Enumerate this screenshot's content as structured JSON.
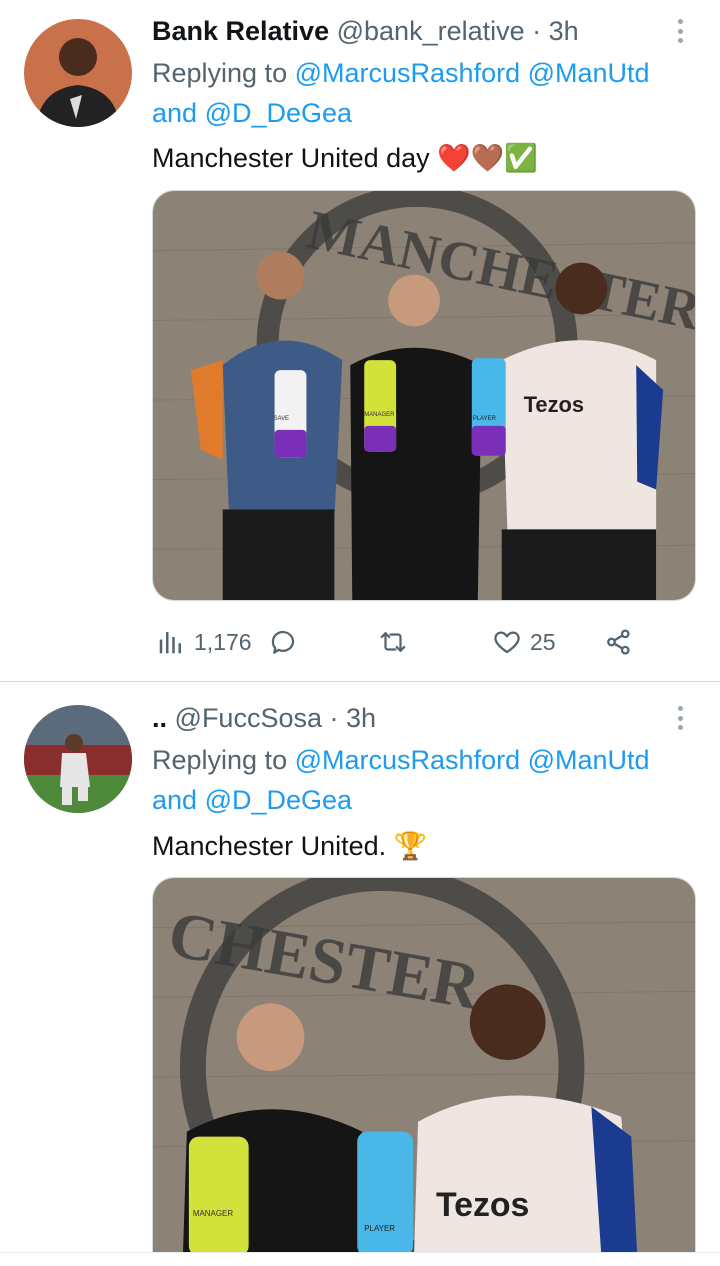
{
  "tweets": [
    {
      "display_name": "Bank Relative",
      "handle": "@bank_relative",
      "separator": "·",
      "time": "3h",
      "replying_prefix": "Replying to",
      "mentions": [
        "@MarcusRashford",
        "@ManUtd",
        "@D_DeGea"
      ],
      "and_word": "and",
      "text": "Manchester United day ❤️🤎✅",
      "image_logo_text": "MANCHESTER",
      "image_sponsor_text": "Tezos",
      "image_trophy_labels": [
        "SAVE",
        "MANAGER",
        "PLAYER"
      ],
      "stats": {
        "views": "1,176",
        "likes": "25"
      }
    },
    {
      "display_name": "..",
      "handle": "@FuccSosa",
      "separator": "·",
      "time": "3h",
      "replying_prefix": "Replying to",
      "mentions": [
        "@MarcusRashford",
        "@ManUtd",
        "@D_DeGea"
      ],
      "and_word": "and",
      "text": "Manchester United. 🏆",
      "image_logo_text": "CHESTER",
      "image_sponsor_text": "Tezos",
      "image_trophy_labels": [
        "MANAGER",
        "PLAYER"
      ]
    }
  ],
  "icons": [
    "more-icon",
    "views-icon",
    "reply-icon",
    "retweet-icon",
    "like-icon",
    "share-icon"
  ],
  "colors": {
    "link": "#1d9bf0",
    "secondary": "#536471",
    "text": "#0f1419",
    "divider": "#cfd9de"
  }
}
